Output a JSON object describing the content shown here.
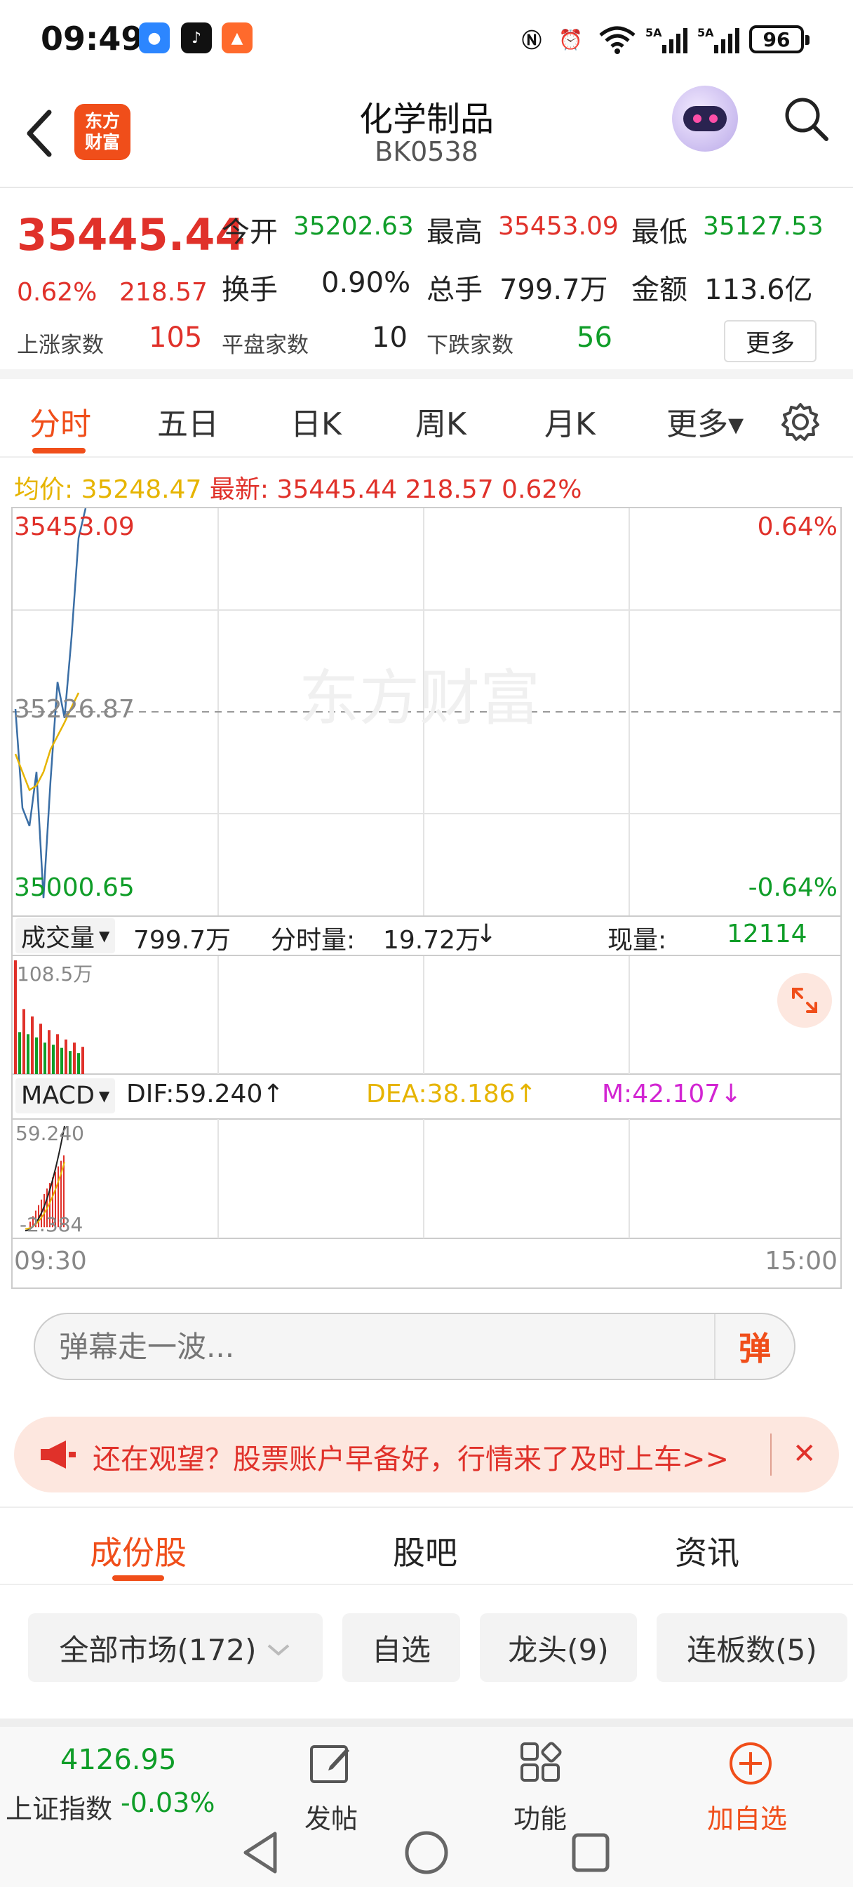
{
  "status_bar": {
    "time": "09:49",
    "battery": "96",
    "icons": [
      "app-icon-1",
      "tiktok-icon",
      "app-icon-3",
      "nfc-icon",
      "alarm-icon",
      "wifi-icon",
      "signal-5a-icon",
      "signal-5a-icon"
    ]
  },
  "header": {
    "title": "化学制品",
    "code": "BK0538",
    "logo_line1": "东方",
    "logo_line2": "财富"
  },
  "quote": {
    "price": "35445.44",
    "change_pct": "0.62%",
    "change": "218.57",
    "open_label": "今开",
    "open": "35202.63",
    "high_label": "最高",
    "high": "35453.09",
    "low_label": "最低",
    "low": "35127.53",
    "turnover_label": "换手",
    "turnover": "0.90%",
    "volume_label": "总手",
    "volume": "799.7万",
    "amount_label": "金额",
    "amount": "113.6亿",
    "up_label": "上涨家数",
    "up": "105",
    "flat_label": "平盘家数",
    "flat": "10",
    "down_label": "下跌家数",
    "down": "56",
    "more": "更多"
  },
  "tabs": [
    "分时",
    "五日",
    "日K",
    "周K",
    "月K",
    "更多▾"
  ],
  "infoline": {
    "avg_label": "均价:",
    "avg": "35248.47",
    "latest_label": "最新:",
    "latest": "35445.44 218.57 0.62%"
  },
  "chart": {
    "y_top": "35453.09",
    "y_mid": "35226.87",
    "y_bottom": "35000.65",
    "pct_top": "0.64%",
    "pct_bottom": "-0.64%",
    "watermark": "东方财富",
    "vol_selector": "成交量",
    "vol_total": "799.7万",
    "vol_period_label": "分时量:",
    "vol_period": "19.72万",
    "vol_now_label": "现量:",
    "vol_now": "12114",
    "vol_max": "108.5万",
    "macd_selector": "MACD",
    "dif": "DIF:59.240",
    "dea": "DEA:38.186",
    "m": "M:42.107",
    "macd_top": "59.240",
    "macd_bottom": "-2.384",
    "time_start": "09:30",
    "time_end": "15:00"
  },
  "chart_data": {
    "type": "line",
    "x_range": [
      "09:30",
      "15:00"
    ],
    "ylim": [
      35000.65,
      35453.09
    ],
    "reference": 35226.87,
    "series": [
      {
        "name": "最新",
        "values": [
          35230,
          35120,
          35100,
          35160,
          35020,
          35150,
          35260,
          35220,
          35310,
          35420,
          35453
        ]
      },
      {
        "name": "均价",
        "values": [
          35180,
          35160,
          35140,
          35145,
          35160,
          35185,
          35200,
          35215,
          35232,
          35248
        ]
      }
    ],
    "volume_max": "108.5万",
    "volume_bars": [
      108.5,
      40,
      62,
      38,
      55,
      35,
      48,
      30,
      42,
      28,
      38,
      25,
      33,
      22,
      30,
      20,
      26
    ],
    "macd": {
      "dif": 59.24,
      "dea": 38.186,
      "m": 42.107,
      "ylim": [
        -2.384,
        59.24
      ]
    }
  },
  "comment": {
    "placeholder": "弹幕走一波...",
    "button": "弹"
  },
  "banner": {
    "text": "还在观望？股票账户早备好，行情来了及时上车>>"
  },
  "subtabs": [
    "成份股",
    "股吧",
    "资讯"
  ],
  "filters": [
    "全部市场(172)",
    "自选",
    "龙头(9)",
    "连板数(5)"
  ],
  "bottom": {
    "index_value": "4126.95",
    "index_name": "上证指数",
    "index_change": "-0.03%",
    "post": "发帖",
    "func": "功能",
    "add": "加自选"
  },
  "colors": {
    "accent": "#f04e1a",
    "up": "#e0312a",
    "down": "#0f9d28",
    "avg": "#e6b400",
    "line": "#3a6ea5"
  }
}
